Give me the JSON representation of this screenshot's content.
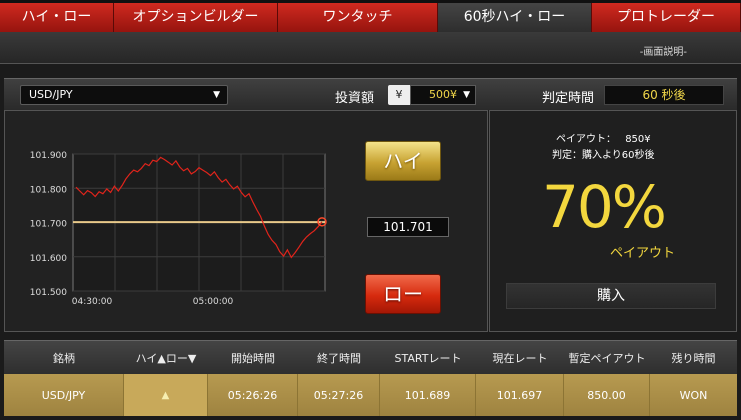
{
  "tabs": [
    {
      "label": "ハイ・ロー",
      "active": false
    },
    {
      "label": "オプションビルダー",
      "active": false
    },
    {
      "label": "ワンタッチ",
      "active": false
    },
    {
      "label": "60秒ハイ・ロー",
      "active": true
    },
    {
      "label": "プロトレーダー",
      "active": false
    }
  ],
  "guide_link": "-画面説明-",
  "controls": {
    "pair": "USD/JPY",
    "amount_label": "投資額",
    "yen_symbol": "¥",
    "amount": "500¥",
    "judge_label": "判定時間",
    "judge_time": "60 秒後"
  },
  "chart_data": {
    "type": "line",
    "x_ticks": [
      "04:30:00",
      "05:00:00"
    ],
    "y_ticks": [
      "101.900",
      "101.800",
      "101.700",
      "101.600",
      "101.500"
    ],
    "ylim": [
      101.5,
      101.9
    ],
    "strike": 101.701,
    "series": [
      {
        "color": "#e0241b",
        "values": [
          101.803,
          101.792,
          101.781,
          101.793,
          101.787,
          101.776,
          101.79,
          101.784,
          101.798,
          101.788,
          101.806,
          101.792,
          101.808,
          101.828,
          101.842,
          101.853,
          101.848,
          101.858,
          101.872,
          101.866,
          101.882,
          101.878,
          101.89,
          101.884,
          101.876,
          101.868,
          101.88,
          101.862,
          101.851,
          101.858,
          101.842,
          101.849,
          101.86,
          101.853,
          101.846,
          101.837,
          101.848,
          101.831,
          101.818,
          101.826,
          101.81,
          101.798,
          101.806,
          101.788,
          101.775,
          101.784,
          101.76,
          101.738,
          101.718,
          101.69,
          101.665,
          101.648,
          101.636,
          101.615,
          101.602,
          101.62,
          101.598,
          101.612,
          101.628,
          101.645,
          101.658,
          101.668,
          101.676,
          101.688,
          101.702
        ]
      }
    ]
  },
  "rate": "101.701",
  "buttons": {
    "high": "ハイ",
    "low": "ロー",
    "buy": "購入"
  },
  "payout": {
    "payout_label": "ペイアウト：",
    "payout_value": "850¥",
    "judge_text": "判定：購入より60秒後",
    "percent": "70%",
    "percent_label": "ペイアウト"
  },
  "table": {
    "headers": [
      "銘柄",
      "ハイ▲ロー▼",
      "開始時間",
      "終了時間",
      "STARTレート",
      "現在レート",
      "暫定ペイアウト",
      "残り時間"
    ],
    "rows": [
      [
        "USD/JPY",
        "▲",
        "05:26:26",
        "05:27:26",
        "101.689",
        "101.697",
        "850.00",
        "WON"
      ]
    ]
  }
}
